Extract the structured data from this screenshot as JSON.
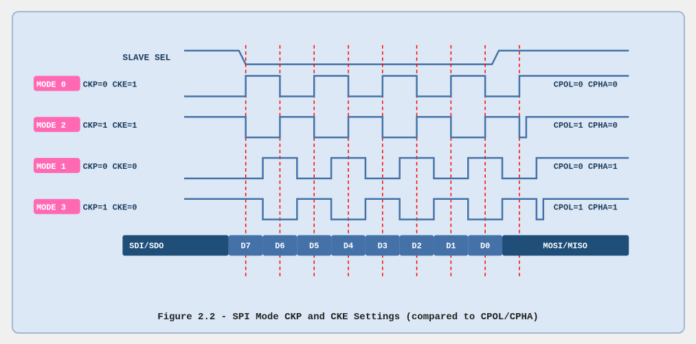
{
  "title": "Figure 2.2 - SPI Mode CKP and CKE Settings (compared to CPOL/CPHA)",
  "caption": "Figure 2.2 - SPI Mode CKP and CKE Settings (compared to CPOL/CPHA)",
  "modes": [
    {
      "label": "MODE 0",
      "params": "CKP=0  CKE=1",
      "cpol": "CPOL=0  CPHA=0"
    },
    {
      "label": "MODE 2",
      "params": "CKP=1  CKE=1",
      "cpol": "CPOL=1  CPHA=0"
    },
    {
      "label": "MODE 1",
      "params": "CKP=0  CKE=0",
      "cpol": "CPOL=0  CPHA=1"
    },
    {
      "label": "MODE 3",
      "params": "CKP=1  CKE=0",
      "cpol": "CPOL=1  CPHA=1"
    }
  ],
  "slave_sel": "SLAVE SEL",
  "data_bits": [
    "SDI/SDO",
    "D7",
    "D6",
    "D5",
    "D4",
    "D3",
    "D2",
    "D1",
    "D0",
    "MOSI/MISO"
  ]
}
